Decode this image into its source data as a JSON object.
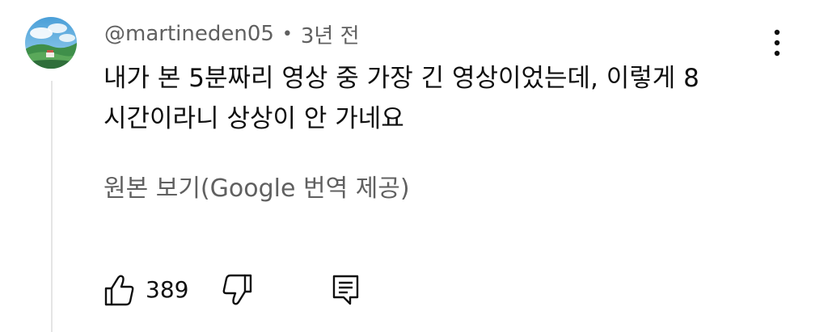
{
  "comment": {
    "author_handle": "@martineden05",
    "separator": "•",
    "timestamp": "3년 전",
    "text": "내가 본 5분짜리 영상 중 가장 긴 영상이었는데, 이렇게 8\n시간이라니 상상이 안 가네요",
    "translate_link": "원본 보기(Google 번역 제공)"
  },
  "actions": {
    "like_count": "389"
  },
  "icons": {
    "menu": "more-vertical-icon",
    "like": "thumbs-up-icon",
    "dislike": "thumbs-down-icon",
    "reply": "comment-reply-icon"
  },
  "colors": {
    "text_primary": "#0f0f0f",
    "text_secondary": "#606060",
    "thread_line": "#e5e5e5"
  }
}
